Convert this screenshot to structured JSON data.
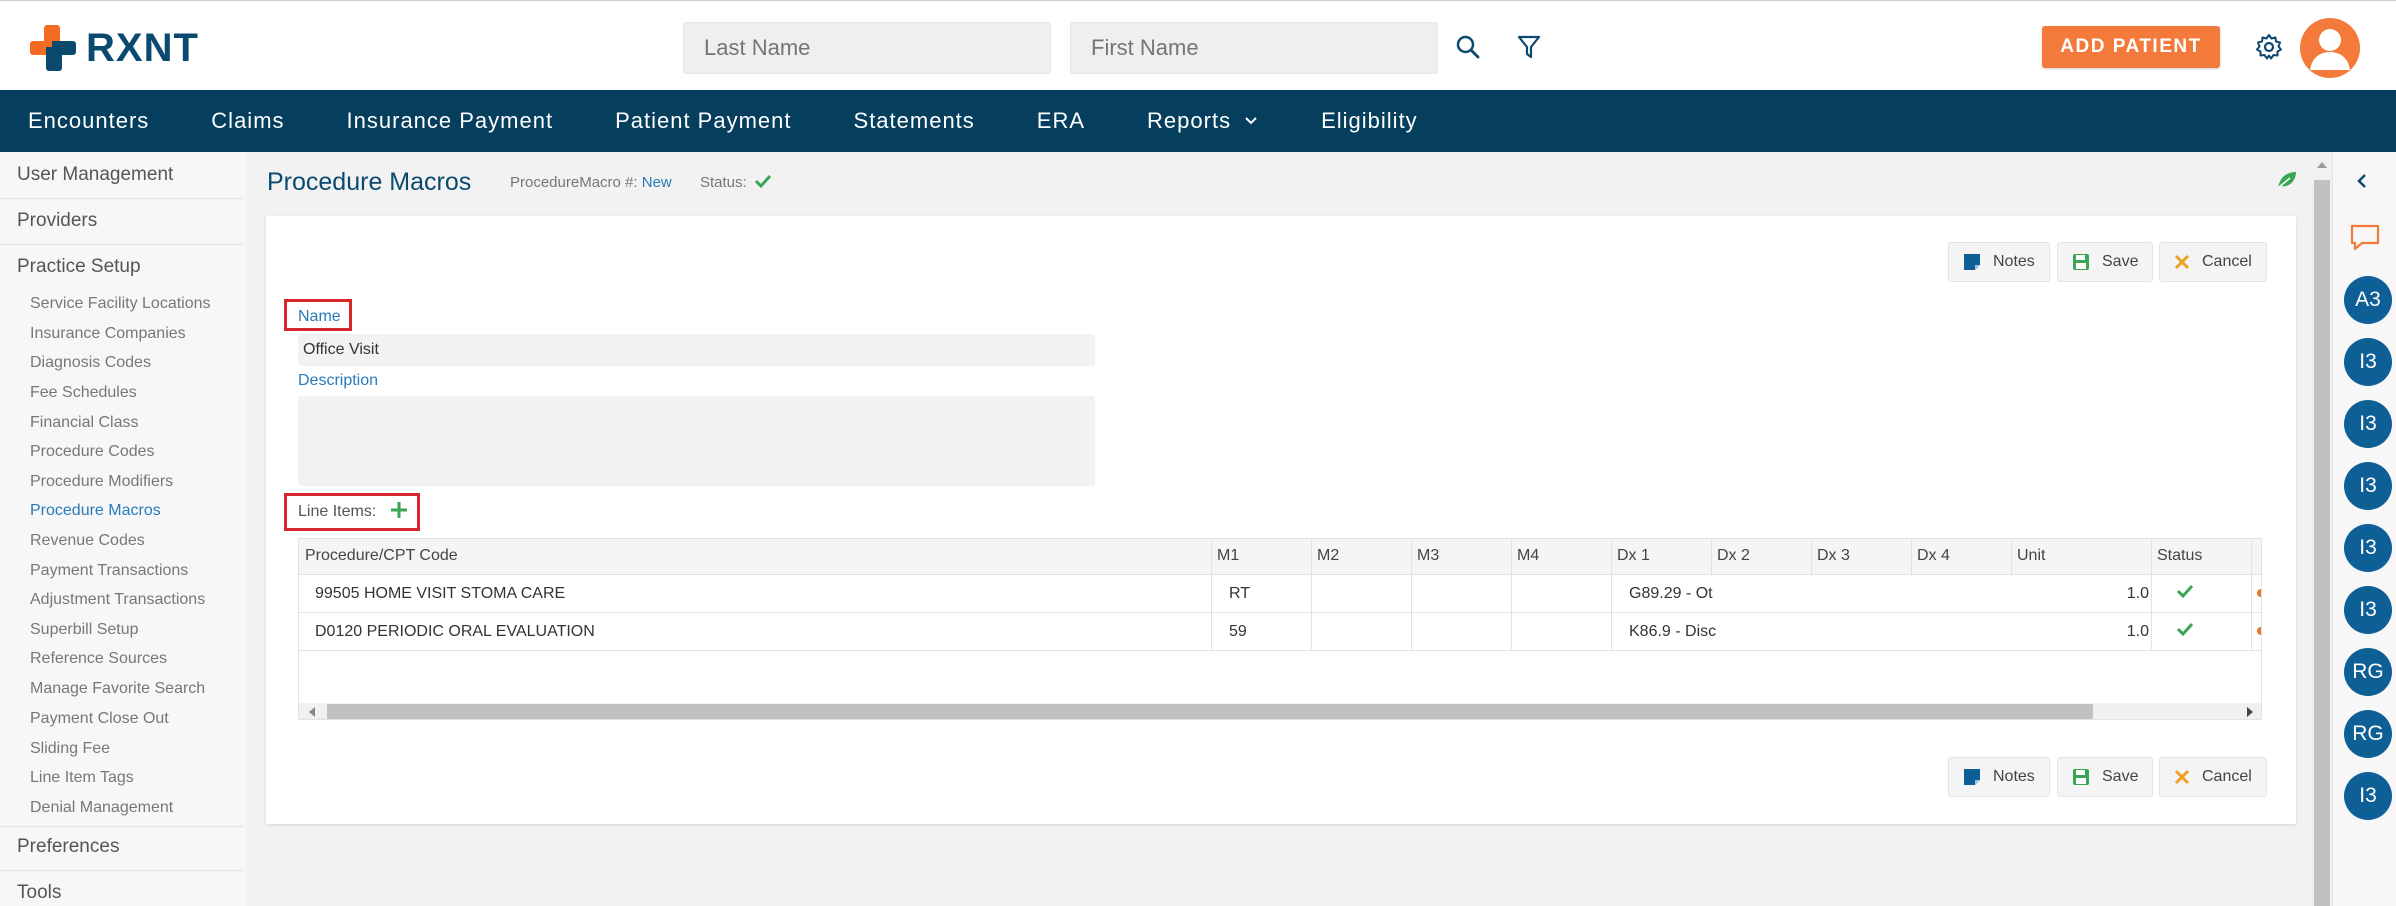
{
  "brand": {
    "name": "RXNT"
  },
  "search": {
    "last_name_placeholder": "Last Name",
    "first_name_placeholder": "First Name"
  },
  "header": {
    "add_patient_label": "ADD PATIENT"
  },
  "nav": {
    "items": [
      "Encounters",
      "Claims",
      "Insurance Payment",
      "Patient Payment",
      "Statements",
      "ERA",
      "Reports",
      "Eligibility"
    ]
  },
  "sidebar": {
    "sections": [
      "User Management",
      "Providers",
      "Practice Setup",
      "Preferences",
      "Tools"
    ],
    "practice_setup_items": [
      "Service Facility Locations",
      "Insurance Companies",
      "Diagnosis Codes",
      "Fee Schedules",
      "Financial Class",
      "Procedure Codes",
      "Procedure Modifiers",
      "Procedure Macros",
      "Revenue Codes",
      "Payment Transactions",
      "Adjustment Transactions",
      "Superbill Setup",
      "Reference Sources",
      "Manage Favorite Search",
      "Payment Close Out",
      "Sliding Fee",
      "Line Item Tags",
      "Denial Management"
    ],
    "active_item": "Procedure Macros"
  },
  "page": {
    "title": "Procedure Macros",
    "macro_label": "ProcedureMacro #:",
    "macro_value": "New",
    "status_label": "Status:"
  },
  "buttons": {
    "notes": "Notes",
    "save": "Save",
    "cancel": "Cancel"
  },
  "form": {
    "name_label": "Name",
    "name_value": "Office Visit",
    "description_label": "Description",
    "description_value": "",
    "line_items_label": "Line Items:"
  },
  "grid": {
    "columns": [
      "Procedure/CPT Code",
      "M1",
      "M2",
      "M3",
      "M4",
      "Dx 1",
      "Dx 2",
      "Dx 3",
      "Dx 4",
      "Unit",
      "Status"
    ],
    "rows": [
      {
        "code": "99505 HOME VISIT STOMA CARE",
        "m1": "RT",
        "m2": "",
        "m3": "",
        "m4": "",
        "dx1": "G89.29 - Ot",
        "dx2": "",
        "dx3": "",
        "dx4": "",
        "unit": "1.0"
      },
      {
        "code": "D0120 PERIODIC ORAL EVALUATION",
        "m1": "59",
        "m2": "",
        "m3": "",
        "m4": "",
        "dx1": "K86.9 - Disc",
        "dx2": "",
        "dx3": "",
        "dx4": "",
        "unit": "1.0"
      }
    ]
  },
  "rightbar": {
    "chips": [
      "A3",
      "I3",
      "I3",
      "I3",
      "I3",
      "I3",
      "RG",
      "RG",
      "I3"
    ]
  },
  "colors": {
    "brand_navy": "#063f5e",
    "accent_orange": "#f47a3c",
    "link_blue": "#2a7ab8",
    "success_green": "#3aa655",
    "highlight_red": "#d9262c"
  }
}
